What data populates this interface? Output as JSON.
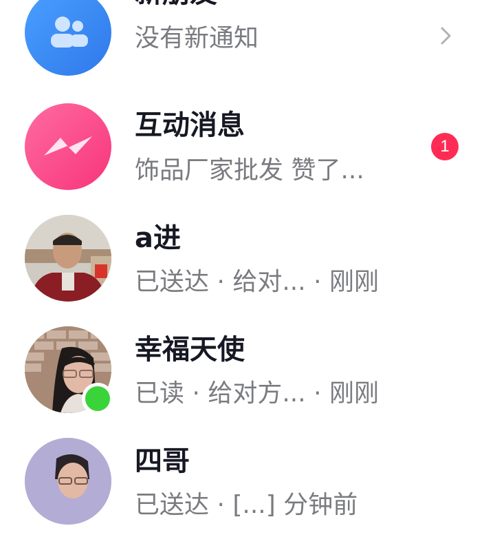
{
  "conversations": [
    {
      "title": "新朋友",
      "subtitle": "没有新通知",
      "avatar_icon": "people-icon"
    },
    {
      "title": "互动消息",
      "subtitle": "饰品厂家批发 赞了...",
      "badge": "1",
      "avatar_icon": "messenger-icon"
    },
    {
      "title": "a进",
      "subtitle": "已送达 · 给对... · 刚刚"
    },
    {
      "title": "幸福天使",
      "subtitle": "已读 · 给对方... · 刚刚",
      "online": true
    },
    {
      "title": "四哥",
      "subtitle": "已送达 · [...] 分钟前"
    }
  ],
  "colors": {
    "accent_blue": "#3d8bf7",
    "accent_pink": "#fe2c55",
    "online_green": "#3ad43a"
  }
}
